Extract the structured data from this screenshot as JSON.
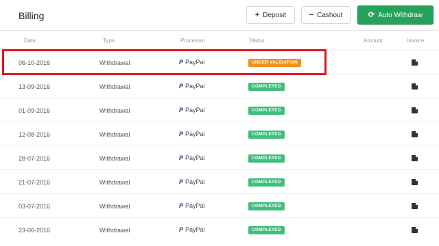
{
  "header": {
    "title": "Billing",
    "deposit_label": "Deposit",
    "cashout_label": "Cashout",
    "auto_withdraw_label": "Auto Withdraw"
  },
  "columns": {
    "date": "Date",
    "type": "Type",
    "processor": "Processor",
    "status": "Status",
    "amount": "Amount",
    "invoice": "Invoice"
  },
  "rows": [
    {
      "date": "06-10-2016",
      "type": "Withdrawal",
      "processor": "PayPal",
      "status": "UNDER VALIDATION",
      "amount": "",
      "highlighted": true
    },
    {
      "date": "13-09-2016",
      "type": "Withdrawal",
      "processor": "PayPal",
      "status": "COMPLETED",
      "amount": ""
    },
    {
      "date": "01-09-2016",
      "type": "Withdrawal",
      "processor": "PayPal",
      "status": "COMPLETED",
      "amount": ""
    },
    {
      "date": "12-08-2016",
      "type": "Withdrawal",
      "processor": "PayPal",
      "status": "COMPLETED",
      "amount": ""
    },
    {
      "date": "28-07-2016",
      "type": "Withdrawal",
      "processor": "PayPal",
      "status": "COMPLETED",
      "amount": ""
    },
    {
      "date": "21-07-2016",
      "type": "Withdrawal",
      "processor": "PayPal",
      "status": "COMPLETED",
      "amount": ""
    },
    {
      "date": "03-07-2016",
      "type": "Withdrawal",
      "processor": "PayPal",
      "status": "COMPLETED",
      "amount": ""
    },
    {
      "date": "23-06-2016",
      "type": "Withdrawal",
      "processor": "PayPal",
      "status": "COMPLETED",
      "amount": ""
    }
  ],
  "colors": {
    "accent": "#27a25b",
    "completed": "#3fbf7d",
    "under_validation": "#f0921e",
    "highlight": "#e3141d"
  },
  "icons": {
    "deposit": "plus-icon",
    "cashout": "minus-icon",
    "auto_withdraw": "refresh-icon",
    "processor": "paypal-icon",
    "invoice": "document-icon"
  }
}
